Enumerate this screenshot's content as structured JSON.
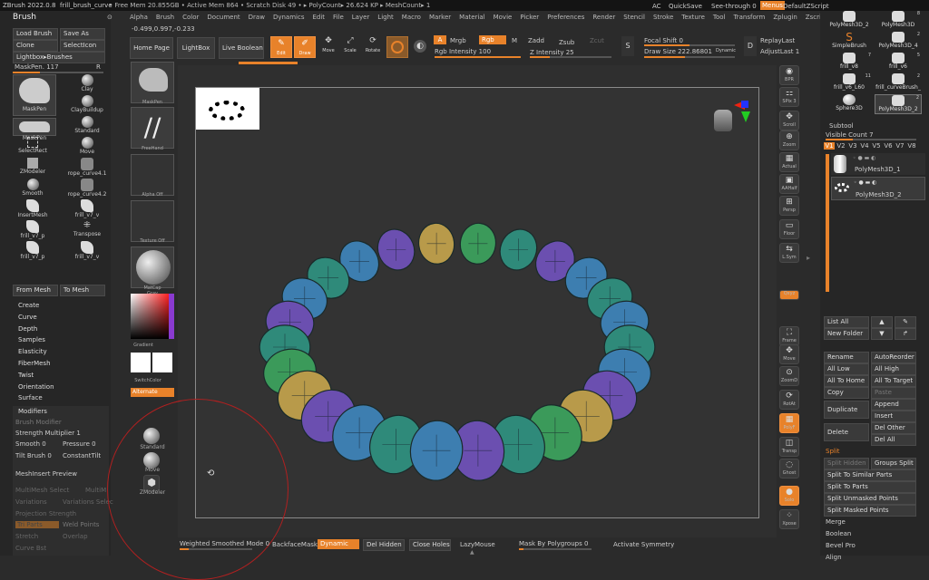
{
  "titlebar": {
    "app": "ZBrush 2022.0.8",
    "file": "frill_brush_curve",
    "stats": "• Free Mem 20.855GB • Active Mem 864 • Scratch Disk 49 • ▸ PolyCount▸ 26.624 KP ▸ MeshCount▸ 1"
  },
  "menus": [
    "Alpha",
    "Brush",
    "Color",
    "Document",
    "Draw",
    "Dynamics",
    "Edit",
    "File",
    "Layer",
    "Light",
    "Macro",
    "Marker",
    "Material",
    "Movie",
    "Picker",
    "Preferences",
    "Render",
    "Stencil",
    "Stroke",
    "Texture",
    "Tool",
    "Transform",
    "Zplugin",
    "Zscript",
    "Help"
  ],
  "top_right": {
    "ac": "AC",
    "quicksave": "QuickSave",
    "seethrough": "See-through  0",
    "menus": "Menus",
    "script": "DefaultZScript"
  },
  "coords": "-0.499,0.997,-0.233",
  "brush_palette": {
    "title": "Brush",
    "load": "Load Brush",
    "saveas": "Save As",
    "clone": "Clone",
    "selecticon": "SelectIcon",
    "lightbox": "Lightbox▸Brushes",
    "maskpen": "MaskPen. 117",
    "r": "R",
    "brushes": [
      "MaskPen",
      "Clay",
      "ClayBuildup",
      "MaskPen",
      "Standard",
      "SelectRect",
      "Move",
      "ZModeler",
      "rope_curve4.1",
      "Smooth",
      "rope_curve4.2",
      "InsertMesh",
      "frill_v7_v",
      "frill_v7_p",
      "Transpose",
      "frill_v7_p",
      "frill_v7_v"
    ],
    "frommesh": "From Mesh",
    "tomesh": "To Mesh"
  },
  "brush_menu": [
    "Create",
    "Curve",
    "Depth",
    "Samples",
    "Elasticity",
    "FiberMesh",
    "Twist",
    "Orientation",
    "Surface"
  ],
  "modifiers": {
    "title": "Modifiers",
    "brushmod": "Brush Modifier",
    "strength": "Strength Multiplier 1",
    "smooth": "Smooth 0",
    "pressure": "Pressure 0",
    "tilt": "Tilt Brush 0",
    "constant": "ConstantTilt",
    "meshinsert": "MeshInsert Preview",
    "multimesh": "MultiMesh Select",
    "multim": "MultiM",
    "variations": "Variations",
    "varsel": "Variations Selec",
    "projstr": "Projection Strength",
    "triparts": "Tri Parts",
    "weldpts": "Weld Points",
    "stretch": "Stretch",
    "overlap": "Overlap",
    "curvebst": "Curve Bst"
  },
  "left_shelf": {
    "maskpen": "MaskPen",
    "freehand": "FreeHand",
    "alphaoff": "Alpha Off",
    "textureoff": "Texture Off",
    "matcap": "MatCap Gray",
    "gradient": "Gradient",
    "switchcolor": "SwitchColor",
    "alternate": "Alternate",
    "standard": "Standard",
    "move": "Move",
    "zmodeler": "ZModeler"
  },
  "toolbar": {
    "homepage": "Home Page",
    "lightbox": "LightBox",
    "liveboolean": "Live Boolean",
    "edit": "Edit",
    "draw": "Draw",
    "move": "Move",
    "scale": "Scale",
    "rotate": "Rotate",
    "a": "A",
    "mrgb": "Mrgb",
    "rgb": "Rgb",
    "m": "M",
    "zadd": "Zadd",
    "zsub": "Zsub",
    "zcut": "Zcut",
    "rgbint": "Rgb Intensity 100",
    "zint": "Z Intensity 25",
    "focal": "Focal Shift 0",
    "drawsize": "Draw Size 222.86801",
    "dynamic": "Dynamic",
    "replaylast": "ReplayLast",
    "adjustlast": "AdjustLast 1"
  },
  "right_shelf": [
    "BPR",
    "SPix 3",
    "Scroll",
    "Zoom",
    "Actual",
    "AAHalf",
    "Persp",
    "Floor",
    "L.Sym",
    "Qxyz",
    "Frame",
    "Move",
    "ZoomD",
    "RotAt",
    "PolyF",
    "Transp",
    "Ghost",
    "Solo",
    "Xpose"
  ],
  "tools": [
    {
      "name": "PolyMesh3D_2",
      "count": ""
    },
    {
      "name": "PolyMesh3D",
      "count": "8"
    },
    {
      "name": "SimpleBrush",
      "count": ""
    },
    {
      "name": "PolyMesh3D_4",
      "count": "2"
    },
    {
      "name": "frill_v8",
      "count": "7"
    },
    {
      "name": "frill_v6",
      "count": "5"
    },
    {
      "name": "frill_v6_L60",
      "count": "11"
    },
    {
      "name": "frill_curveBrush_",
      "count": "2"
    },
    {
      "name": "Sphere3D",
      "count": ""
    },
    {
      "name": "PolyMesh3D_2",
      "count": "2"
    }
  ],
  "subtool": {
    "title": "Subtool",
    "visiblecount": "Visible Count 7",
    "versions": [
      "V1",
      "V2",
      "V3",
      "V4",
      "V5",
      "V6",
      "V7",
      "V8"
    ],
    "items": [
      "PolyMesh3D_1",
      "PolyMesh3D_2"
    ],
    "listall": "List All",
    "newfolder": "New Folder",
    "rename": "Rename",
    "autoreorder": "AutoReorder",
    "alllow": "All Low",
    "allhigh": "All High",
    "alltohome": "All To Home",
    "alltotarget": "All To Target",
    "copy": "Copy",
    "paste": "Paste",
    "duplicate": "Duplicate",
    "append": "Append",
    "insert": "Insert",
    "delete": "Delete",
    "delother": "Del Other",
    "delall": "Del All",
    "split": "Split",
    "splithidden": "Split Hidden",
    "groupssplit": "Groups Split",
    "splitsimilar": "Split To Similar Parts",
    "splitparts": "Split To Parts",
    "splitunmasked": "Split Unmasked Points",
    "splitmasked": "Split Masked Points",
    "merge": "Merge",
    "boolean": "Boolean",
    "bevelpro": "Bevel Pro",
    "align": "Align"
  },
  "bottombar": {
    "wsm": "Weighted Smoothed Mode 0",
    "backface": "BackfaceMask",
    "dynamic": "Dynamic",
    "delhidden": "Del Hidden",
    "closeholes": "Close Holes",
    "lazymouse": "LazyMouse",
    "maskbypoly": "Mask By Polygroups 0",
    "activesym": "Activate Symmetry"
  },
  "colors": {
    "accent": "#e8822a",
    "bg": "#2b2b2b",
    "panel": "#262626",
    "mesh_teal": "#2f8a7a",
    "mesh_blue": "#3d7eb0",
    "mesh_purple": "#6b4fb0",
    "mesh_gold": "#b89a4a",
    "mesh_green": "#3b9a5a"
  }
}
